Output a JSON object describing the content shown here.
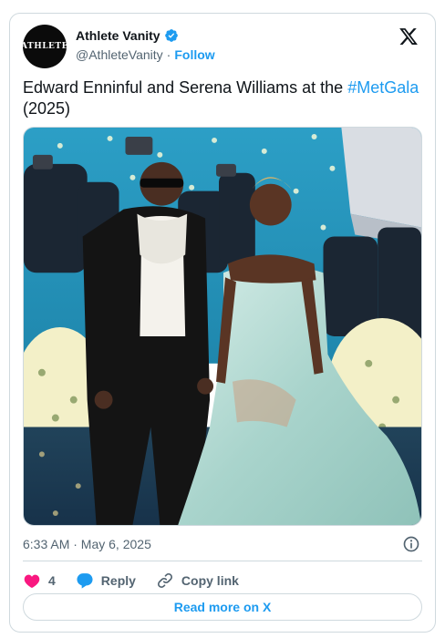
{
  "author": {
    "avatar_text": "ATHLETE",
    "display_name": "Athlete Vanity",
    "handle": "@AthleteVanity",
    "separator": "·",
    "follow_label": "Follow"
  },
  "tweet": {
    "text_prefix": "Edward Enninful and Serena Williams at the ",
    "hashtag": "#MetGala",
    "text_suffix": " (2025)",
    "timestamp": "6:33 AM · May 6, 2025"
  },
  "actions": {
    "like_count": "4",
    "reply_label": "Reply",
    "copy_link_label": "Copy link",
    "read_more_label": "Read more on X"
  },
  "colors": {
    "accent": "#1d9bf0",
    "like": "#f91880",
    "text_primary": "#0f1419",
    "text_secondary": "#536471",
    "border": "#cfd9de"
  },
  "icons": [
    "verified-badge-icon",
    "x-logo-icon",
    "info-icon",
    "heart-icon",
    "reply-bubble-icon",
    "link-icon"
  ]
}
